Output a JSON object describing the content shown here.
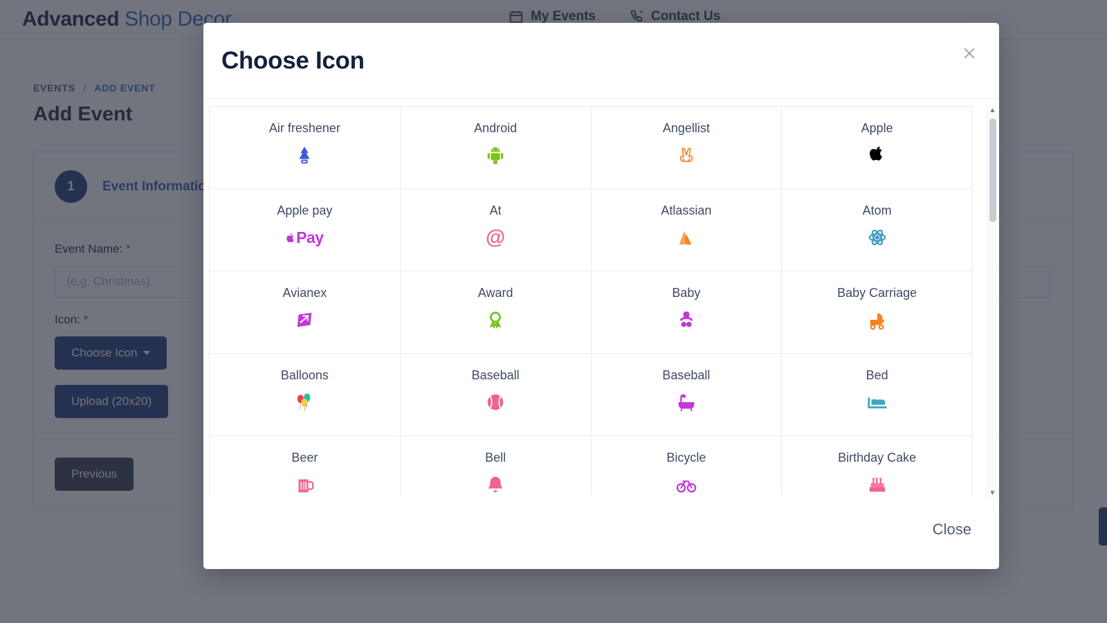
{
  "header": {
    "brand_strong": "Advanced",
    "brand_light": "Shop Decor",
    "nav": [
      {
        "label": "My Events",
        "icon": "calendar-icon"
      },
      {
        "label": "Contact Us",
        "icon": "phone-ring-icon"
      }
    ]
  },
  "breadcrumb": {
    "root": "EVENTS",
    "separator": "/",
    "current": "ADD EVENT"
  },
  "page": {
    "title": "Add Event"
  },
  "form": {
    "step_number": "1",
    "step_label": "Event Information",
    "event_name_label": "Event Name:",
    "required_mark": "*",
    "event_name_value": "",
    "event_name_placeholder": "(e.g. Christmas)",
    "icon_label": "Icon:",
    "choose_icon_button": "Choose Icon",
    "upload_button": "Upload (20x20)",
    "previous_button": "Previous"
  },
  "modal": {
    "title": "Choose Icon",
    "close_icon": "close-icon",
    "close_button": "Close",
    "scrollbar": {
      "up_arrow": "▲",
      "down_arrow": "▼"
    },
    "icons": [
      {
        "name": "Air freshener",
        "glyph": "air-freshener-icon",
        "color": "#3b5bdb"
      },
      {
        "name": "Android",
        "glyph": "android-icon",
        "color": "#78c51c"
      },
      {
        "name": "Angellist",
        "glyph": "angellist-icon",
        "color": "#f48024"
      },
      {
        "name": "Apple",
        "glyph": "apple-icon",
        "color": "#000000"
      },
      {
        "name": "Apple pay",
        "glyph": "apple-pay-icon",
        "color": "#c237d8"
      },
      {
        "name": "At",
        "glyph": "at-icon",
        "color": "#f0648c"
      },
      {
        "name": "Atlassian",
        "glyph": "atlassian-icon",
        "color": "#f58220"
      },
      {
        "name": "Atom",
        "glyph": "atom-icon",
        "color": "#42a0bd"
      },
      {
        "name": "Avianex",
        "glyph": "avianex-icon",
        "color": "#c237d8"
      },
      {
        "name": "Award",
        "glyph": "award-icon",
        "color": "#76c21c"
      },
      {
        "name": "Baby",
        "glyph": "baby-icon",
        "color": "#c237d8"
      },
      {
        "name": "Baby Carriage",
        "glyph": "baby-carriage-icon",
        "color": "#f58220"
      },
      {
        "name": "Balloons",
        "glyph": "balloons-icon",
        "color": "#e8405a"
      },
      {
        "name": "Baseball",
        "glyph": "baseball-ball-icon",
        "color": "#f0648c"
      },
      {
        "name": "Baseball",
        "glyph": "bath-icon",
        "color": "#c237d8"
      },
      {
        "name": "Bed",
        "glyph": "bed-icon",
        "color": "#3aa8c1"
      },
      {
        "name": "Beer",
        "glyph": "beer-icon",
        "color": "#f0648c"
      },
      {
        "name": "Bell",
        "glyph": "bell-icon",
        "color": "#f0648c"
      },
      {
        "name": "Bicycle",
        "glyph": "bicycle-icon",
        "color": "#c237d8"
      },
      {
        "name": "Birthday Cake",
        "glyph": "birthday-cake-icon",
        "color": "#f0648c"
      }
    ]
  },
  "colors": {
    "brand_dark": "#11204a",
    "brand_blue": "#3861b5",
    "primary_button": "#1f3a7a",
    "secondary_button": "#343d51",
    "overlay": "rgba(41,46,59,0.66)",
    "required": "#b32046"
  }
}
